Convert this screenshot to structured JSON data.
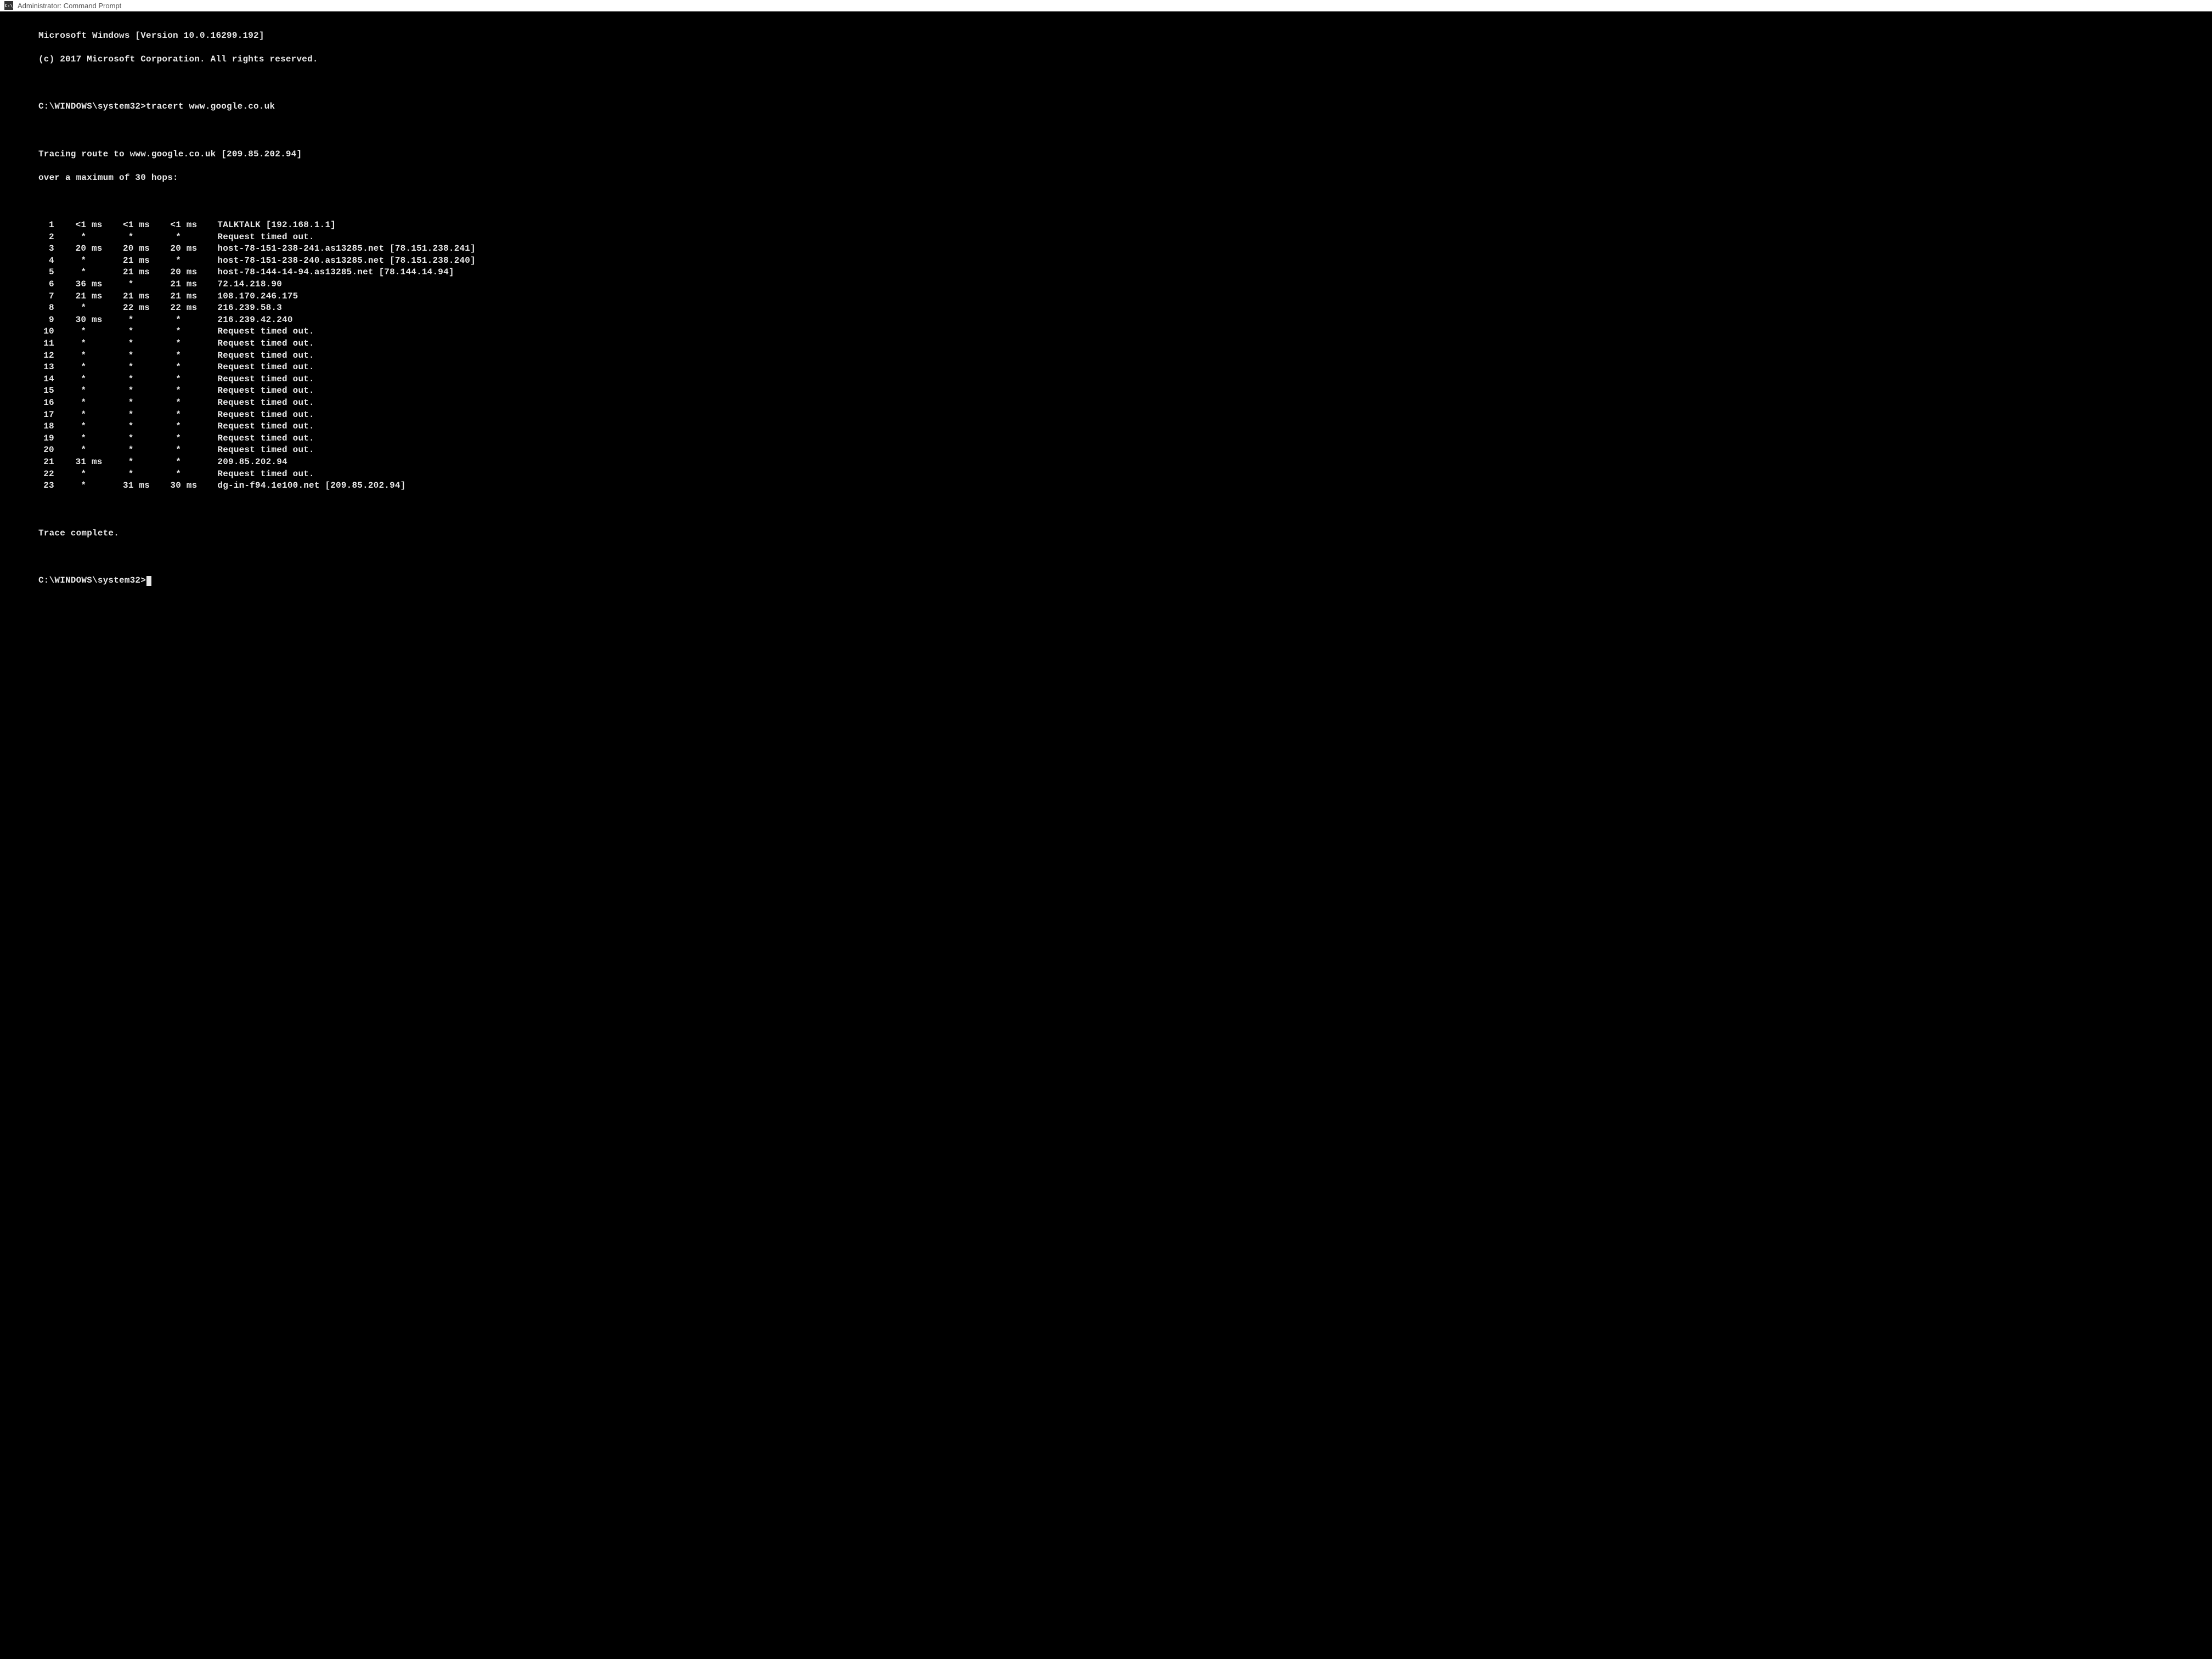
{
  "title_bar": {
    "icon_label": "C:\\",
    "title": "Administrator: Command Prompt"
  },
  "header": {
    "version_line": "Microsoft Windows [Version 10.0.16299.192]",
    "copyright_line": "(c) 2017 Microsoft Corporation. All rights reserved."
  },
  "command": {
    "prompt": "C:\\WINDOWS\\system32>",
    "cmd": "tracert www.google.co.uk"
  },
  "trace_header": {
    "line1": "Tracing route to www.google.co.uk [209.85.202.94]",
    "line2": "over a maximum of 30 hops:"
  },
  "hops": [
    {
      "n": "1",
      "t1": "<1 ms",
      "t2": "<1 ms",
      "t3": "<1 ms",
      "host": "TALKTALK [192.168.1.1]"
    },
    {
      "n": "2",
      "t1": "*",
      "t2": "*",
      "t3": "*",
      "host": "Request timed out."
    },
    {
      "n": "3",
      "t1": "20 ms",
      "t2": "20 ms",
      "t3": "20 ms",
      "host": "host-78-151-238-241.as13285.net [78.151.238.241]"
    },
    {
      "n": "4",
      "t1": "*",
      "t2": "21 ms",
      "t3": "*",
      "host": "host-78-151-238-240.as13285.net [78.151.238.240]"
    },
    {
      "n": "5",
      "t1": "*",
      "t2": "21 ms",
      "t3": "20 ms",
      "host": "host-78-144-14-94.as13285.net [78.144.14.94]"
    },
    {
      "n": "6",
      "t1": "36 ms",
      "t2": "*",
      "t3": "21 ms",
      "host": "72.14.218.90"
    },
    {
      "n": "7",
      "t1": "21 ms",
      "t2": "21 ms",
      "t3": "21 ms",
      "host": "108.170.246.175"
    },
    {
      "n": "8",
      "t1": "*",
      "t2": "22 ms",
      "t3": "22 ms",
      "host": "216.239.58.3"
    },
    {
      "n": "9",
      "t1": "30 ms",
      "t2": "*",
      "t3": "*",
      "host": "216.239.42.240"
    },
    {
      "n": "10",
      "t1": "*",
      "t2": "*",
      "t3": "*",
      "host": "Request timed out."
    },
    {
      "n": "11",
      "t1": "*",
      "t2": "*",
      "t3": "*",
      "host": "Request timed out."
    },
    {
      "n": "12",
      "t1": "*",
      "t2": "*",
      "t3": "*",
      "host": "Request timed out."
    },
    {
      "n": "13",
      "t1": "*",
      "t2": "*",
      "t3": "*",
      "host": "Request timed out."
    },
    {
      "n": "14",
      "t1": "*",
      "t2": "*",
      "t3": "*",
      "host": "Request timed out."
    },
    {
      "n": "15",
      "t1": "*",
      "t2": "*",
      "t3": "*",
      "host": "Request timed out."
    },
    {
      "n": "16",
      "t1": "*",
      "t2": "*",
      "t3": "*",
      "host": "Request timed out."
    },
    {
      "n": "17",
      "t1": "*",
      "t2": "*",
      "t3": "*",
      "host": "Request timed out."
    },
    {
      "n": "18",
      "t1": "*",
      "t2": "*",
      "t3": "*",
      "host": "Request timed out."
    },
    {
      "n": "19",
      "t1": "*",
      "t2": "*",
      "t3": "*",
      "host": "Request timed out."
    },
    {
      "n": "20",
      "t1": "*",
      "t2": "*",
      "t3": "*",
      "host": "Request timed out."
    },
    {
      "n": "21",
      "t1": "31 ms",
      "t2": "*",
      "t3": "*",
      "host": "209.85.202.94"
    },
    {
      "n": "22",
      "t1": "*",
      "t2": "*",
      "t3": "*",
      "host": "Request timed out."
    },
    {
      "n": "23",
      "t1": "*",
      "t2": "31 ms",
      "t3": "30 ms",
      "host": "dg-in-f94.1e100.net [209.85.202.94]"
    }
  ],
  "footer": {
    "complete": "Trace complete.",
    "prompt": "C:\\WINDOWS\\system32>"
  }
}
